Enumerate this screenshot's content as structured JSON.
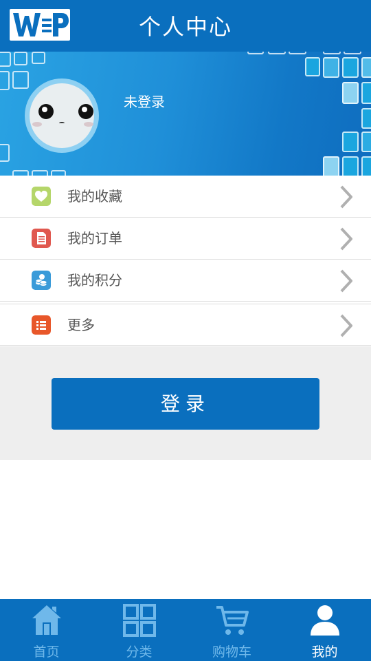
{
  "header": {
    "title": "个人中心",
    "logo_text": "WP"
  },
  "profile": {
    "status": "未登录"
  },
  "menu": [
    {
      "label": "我的收藏",
      "icon": "heart-icon",
      "color": "#b5d66a"
    },
    {
      "label": "我的订单",
      "icon": "document-icon",
      "color": "#e0584f"
    },
    {
      "label": "我的积分",
      "icon": "coins-icon",
      "color": "#3a9bd9"
    },
    {
      "label": "更多",
      "icon": "list-icon",
      "color": "#e8572a"
    }
  ],
  "login": {
    "label": "登录"
  },
  "tabbar": [
    {
      "label": "首页",
      "icon": "home-icon",
      "active": false
    },
    {
      "label": "分类",
      "icon": "grid-icon",
      "active": false
    },
    {
      "label": "购物车",
      "icon": "cart-icon",
      "active": false
    },
    {
      "label": "我的",
      "icon": "user-icon",
      "active": true
    }
  ],
  "colors": {
    "primary": "#0a6fbe",
    "tab_inactive": "#6fb8ea",
    "tab_active": "#ffffff"
  }
}
